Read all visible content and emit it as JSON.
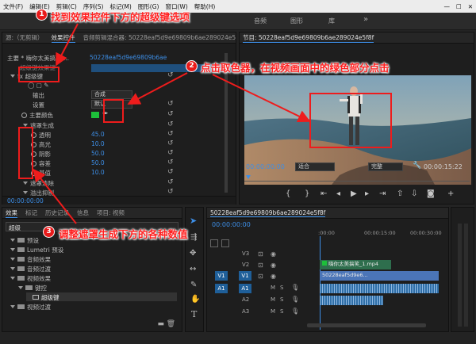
{
  "menu": [
    "文件(F)",
    "编辑(E)",
    "剪辑(C)",
    "序列(S)",
    "标记(M)",
    "图形(G)",
    "窗口(W)",
    "帮助(H)"
  ],
  "window_controls": {
    "min": "—",
    "max": "☐",
    "close": "✕"
  },
  "workspaces": [
    "音频",
    "图形",
    "库"
  ],
  "effect_controls": {
    "tabs": [
      "源:（无剪辑）",
      "效果控件",
      "音频剪辑混合器: 50228eaf5d9e69809b6ae289024e5f8f"
    ],
    "clip_path": "主要 * 嗨你太美搞笑 ...",
    "seq_path": "50228eaf5d9e69809b6ae",
    "rows": {
      "hidden_top": "超级键效果键",
      "ultra_key": "超级键",
      "output_label": "输出",
      "output_value": "合成",
      "setting_label": "设置",
      "setting_value": "默认",
      "key_color_label": "主要颜色",
      "matte_gen": "遮罩生成",
      "transparency": "透明",
      "transparency_val": "45.0",
      "highlight": "高光",
      "highlight_val": "10.0",
      "shadow": "阴影",
      "shadow_val": "50.0",
      "tolerance": "容差",
      "tolerance_val": "50.0",
      "pedestal": "基值",
      "pedestal_val": "10.0",
      "matte_cleanup": "遮罩清除",
      "spill_suppress": "溢出抑制"
    },
    "timecode": "00:00:00:00"
  },
  "program": {
    "title": "节目: 50228eaf5d9e69809b6ae289024e5f8f",
    "timecode": "00:00:00:00",
    "fit": "适合",
    "quality": "完整",
    "duration": "00:00:15:22"
  },
  "project": {
    "tabs": [
      "效果",
      "标记",
      "历史记录",
      "信息",
      "项目: 视频"
    ],
    "search_value": "超级",
    "tree": [
      "预设",
      "Lumetri 预设",
      "音频效果",
      "音频过渡",
      "视频效果",
      "键控",
      "超级键",
      "视频过渡"
    ]
  },
  "timeline": {
    "name": "50228eaf5d9e69809b6ae289024e5f8f",
    "timecode": "00:00:00:00",
    "ruler": [
      ":00:00",
      "00:00:15:00",
      "00:00:30:00"
    ],
    "tracks": [
      "V3",
      "V2",
      "V1",
      "A1",
      "A2",
      "A3"
    ],
    "source_patch": [
      "V1",
      "A1"
    ],
    "clip_v2": "嗨你太美搞笑_1.mp4",
    "clip_v1": "50228eaf5d9e6...",
    "track_flags": [
      "M",
      "S"
    ]
  },
  "annotations": [
    {
      "num": "1",
      "text": "找到效果控件下方的超级键选项"
    },
    {
      "num": "2",
      "text": "点击取色器，在视频画面中的绿色部分点击"
    },
    {
      "num": "3",
      "text": "调整遮罩生成下方的各种数值"
    }
  ],
  "colors": {
    "accent": "#3d8ee6",
    "callout": "#ff1f1f",
    "key_color": "#1dbf3a",
    "clip_v2": "#3a8a5c",
    "clip_v1": "#4b75b8",
    "audio": "#2f6fa8"
  }
}
